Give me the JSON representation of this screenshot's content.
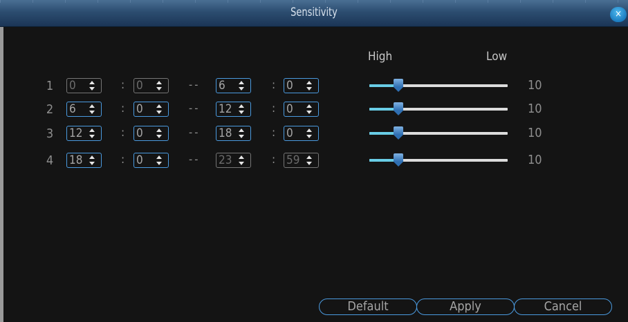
{
  "dialog": {
    "title": "Sensitivity",
    "close_label": "×"
  },
  "columns": {
    "high": "High",
    "low": "Low"
  },
  "separators": {
    "colon": ":",
    "dash": "--"
  },
  "rows": [
    {
      "num": "1",
      "start_hour": "0",
      "start_min": "0",
      "end_hour": "6",
      "end_min": "0",
      "sensitivity": "10",
      "level": 10,
      "start_enabled": false,
      "end_enabled": true,
      "end_min_enabled": true
    },
    {
      "num": "2",
      "start_hour": "6",
      "start_min": "0",
      "end_hour": "12",
      "end_min": "0",
      "sensitivity": "10",
      "level": 10,
      "start_enabled": true,
      "end_enabled": true,
      "end_min_enabled": true
    },
    {
      "num": "3",
      "start_hour": "12",
      "start_min": "0",
      "end_hour": "18",
      "end_min": "0",
      "sensitivity": "10",
      "level": 10,
      "start_enabled": true,
      "end_enabled": true,
      "end_min_enabled": true
    },
    {
      "num": "4",
      "start_hour": "18",
      "start_min": "0",
      "end_hour": "23",
      "end_min": "59",
      "sensitivity": "10",
      "level": 10,
      "start_enabled": true,
      "end_enabled": false,
      "end_min_enabled": false
    }
  ],
  "slider": {
    "min": 1,
    "max": 80
  },
  "buttons": {
    "default": "Default",
    "apply": "Apply",
    "cancel": "Cancel"
  },
  "colors": {
    "titlebar": "#2c4d70",
    "accent_border": "#4b9be0",
    "slider_fill": "#69cde6",
    "background": "#141414"
  }
}
